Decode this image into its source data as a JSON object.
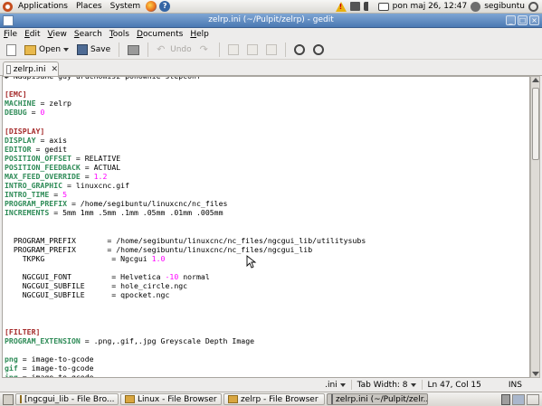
{
  "top_panel": {
    "menus": [
      "Applications",
      "Places",
      "System"
    ],
    "datetime": "pon maj 26, 12:47",
    "username": "segibuntu"
  },
  "window": {
    "title": "zelrp.ini (~/Pulpit/zelrp) - gedit",
    "buttons": [
      "_",
      "□",
      "×"
    ]
  },
  "menubar": {
    "items": [
      {
        "label": "File",
        "mnemonic": "F",
        "rest": "ile"
      },
      {
        "label": "Edit",
        "mnemonic": "E",
        "rest": "dit"
      },
      {
        "label": "View",
        "mnemonic": "V",
        "rest": "iew"
      },
      {
        "label": "Search",
        "mnemonic": "S",
        "rest": "earch"
      },
      {
        "label": "Tools",
        "mnemonic": "T",
        "rest": "ools"
      },
      {
        "label": "Documents",
        "mnemonic": "D",
        "rest": "ocuments"
      },
      {
        "label": "Help",
        "mnemonic": "H",
        "rest": "elp"
      }
    ]
  },
  "toolbar": {
    "open_label": "Open",
    "save_label": "Save",
    "undo_label": "Undo"
  },
  "tab": {
    "label": "zelrp.ini"
  },
  "editor": {
    "lines": [
      [
        {
          "t": "# Nadpisane gdy uruchomisz ponownie stepconf",
          "c": ""
        }
      ],
      [
        {
          "t": "",
          "c": ""
        }
      ],
      [
        {
          "t": "[EMC]",
          "c": "s"
        }
      ],
      [
        {
          "t": "MACHINE",
          "c": "k"
        },
        {
          "t": " = zelrp",
          "c": ""
        }
      ],
      [
        {
          "t": "DEBUG",
          "c": "k"
        },
        {
          "t": " = ",
          "c": ""
        },
        {
          "t": "0",
          "c": "n"
        }
      ],
      [
        {
          "t": "",
          "c": ""
        }
      ],
      [
        {
          "t": "[DISPLAY]",
          "c": "s"
        }
      ],
      [
        {
          "t": "DISPLAY",
          "c": "k"
        },
        {
          "t": " = axis",
          "c": ""
        }
      ],
      [
        {
          "t": "EDITOR",
          "c": "k"
        },
        {
          "t": " = gedit",
          "c": ""
        }
      ],
      [
        {
          "t": "POSITION_OFFSET",
          "c": "k"
        },
        {
          "t": " = RELATIVE",
          "c": ""
        }
      ],
      [
        {
          "t": "POSITION_FEEDBACK",
          "c": "k"
        },
        {
          "t": " = ACTUAL",
          "c": ""
        }
      ],
      [
        {
          "t": "MAX_FEED_OVERRIDE",
          "c": "k"
        },
        {
          "t": " = ",
          "c": ""
        },
        {
          "t": "1.2",
          "c": "n"
        }
      ],
      [
        {
          "t": "INTRO_GRAPHIC",
          "c": "k"
        },
        {
          "t": " = linuxcnc.gif",
          "c": ""
        }
      ],
      [
        {
          "t": "INTRO_TIME",
          "c": "k"
        },
        {
          "t": " = ",
          "c": ""
        },
        {
          "t": "5",
          "c": "n"
        }
      ],
      [
        {
          "t": "PROGRAM_PREFIX",
          "c": "k"
        },
        {
          "t": " = /home/segibuntu/linuxcnc/nc_files",
          "c": ""
        }
      ],
      [
        {
          "t": "INCREMENTS",
          "c": "k"
        },
        {
          "t": " = 5mm 1mm .5mm .1mm .05mm .01mm .005mm",
          "c": ""
        }
      ],
      [
        {
          "t": "",
          "c": ""
        }
      ],
      [
        {
          "t": "",
          "c": ""
        }
      ],
      [
        {
          "t": "  PROGRAM_PREFIX       = /home/segibuntu/linuxcnc/nc_files/ngcgui_lib/utilitysubs",
          "c": ""
        }
      ],
      [
        {
          "t": "  PROGRAM_PREFIX       = /home/segibuntu/linuxcnc/nc_files/ngcgui_lib",
          "c": ""
        }
      ],
      [
        {
          "t": "    TKPKG               = Ngcgui ",
          "c": ""
        },
        {
          "t": "1.0",
          "c": "n"
        }
      ],
      [
        {
          "t": "",
          "c": ""
        }
      ],
      [
        {
          "t": "    NGCGUI_FONT         = Helvetica ",
          "c": ""
        },
        {
          "t": "-10",
          "c": "n"
        },
        {
          "t": " normal",
          "c": ""
        }
      ],
      [
        {
          "t": "    NGCGUI_SUBFILE      = hole_circle.ngc",
          "c": ""
        }
      ],
      [
        {
          "t": "    NGCGUI_SUBFILE      = qpocket.ngc",
          "c": ""
        }
      ],
      [
        {
          "t": "",
          "c": ""
        }
      ],
      [
        {
          "t": "",
          "c": ""
        }
      ],
      [
        {
          "t": "",
          "c": ""
        }
      ],
      [
        {
          "t": "[FILTER]",
          "c": "s"
        }
      ],
      [
        {
          "t": "PROGRAM_EXTENSION",
          "c": "k"
        },
        {
          "t": " = .png,.gif,.jpg Greyscale Depth Image",
          "c": ""
        }
      ],
      [
        {
          "t": "",
          "c": ""
        }
      ],
      [
        {
          "t": "png",
          "c": "k"
        },
        {
          "t": " = image-to-gcode",
          "c": ""
        }
      ],
      [
        {
          "t": "gif",
          "c": "k"
        },
        {
          "t": " = image-to-gcode",
          "c": ""
        }
      ],
      [
        {
          "t": "jpg",
          "c": "k"
        },
        {
          "t": " = image-to-gcode",
          "c": ""
        }
      ]
    ]
  },
  "statusbar": {
    "language": ".ini",
    "tab_width": "Tab Width: 8",
    "position": "Ln 47, Col 15",
    "mode": "INS"
  },
  "taskbar": {
    "tasks": [
      {
        "label": "[ngcgui_lib - File Bro...",
        "icon": "folder-icon",
        "active": false
      },
      {
        "label": "Linux - File Browser",
        "icon": "folder-icon",
        "active": false
      },
      {
        "label": "zelrp - File Browser",
        "icon": "folder-icon",
        "active": false
      },
      {
        "label": "zelrp.ini (~/Pulpit/zelr...",
        "icon": "gedit-icon",
        "active": true
      }
    ]
  }
}
